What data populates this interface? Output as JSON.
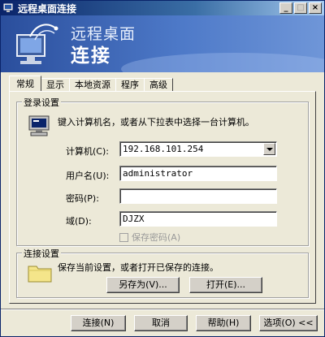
{
  "window": {
    "title": "远程桌面连接",
    "controls": {
      "minimize": "_",
      "maximize": "□",
      "close": "×"
    }
  },
  "banner": {
    "line1": "远程桌面",
    "line2": "连接"
  },
  "tabs": [
    {
      "label": "常规",
      "active": true
    },
    {
      "label": "显示",
      "active": false
    },
    {
      "label": "本地资源",
      "active": false
    },
    {
      "label": "程序",
      "active": false
    },
    {
      "label": "高级",
      "active": false
    }
  ],
  "login": {
    "legend": "登录设置",
    "hint": "键入计算机名，或者从下拉表中选择一台计算机。",
    "computer_label": "计算机(C):",
    "computer_value": "192.168.101.254",
    "username_label": "用户名(U):",
    "username_value": "administrator",
    "password_label": "密码(P):",
    "password_value": "",
    "domain_label": "域(D):",
    "domain_value": "DJZX",
    "save_password_label": "保存密码(A)"
  },
  "connection": {
    "legend": "连接设置",
    "hint": "保存当前设置，或者打开已保存的连接。",
    "save_as_label": "另存为(V)...",
    "open_label": "打开(E)..."
  },
  "footer": {
    "connect_label": "连接(N)",
    "cancel_label": "取消",
    "help_label": "帮助(H)",
    "options_label": "选项(O) <<"
  },
  "icons": {
    "app": "remote-desktop-icon",
    "banner": "remote-desktop-banner-icon",
    "computer": "computer-icon",
    "folder": "folder-icon"
  },
  "colors": {
    "title_bar": "#0a246a",
    "banner": "#4d79c8",
    "window_bg": "#ece9d8"
  }
}
